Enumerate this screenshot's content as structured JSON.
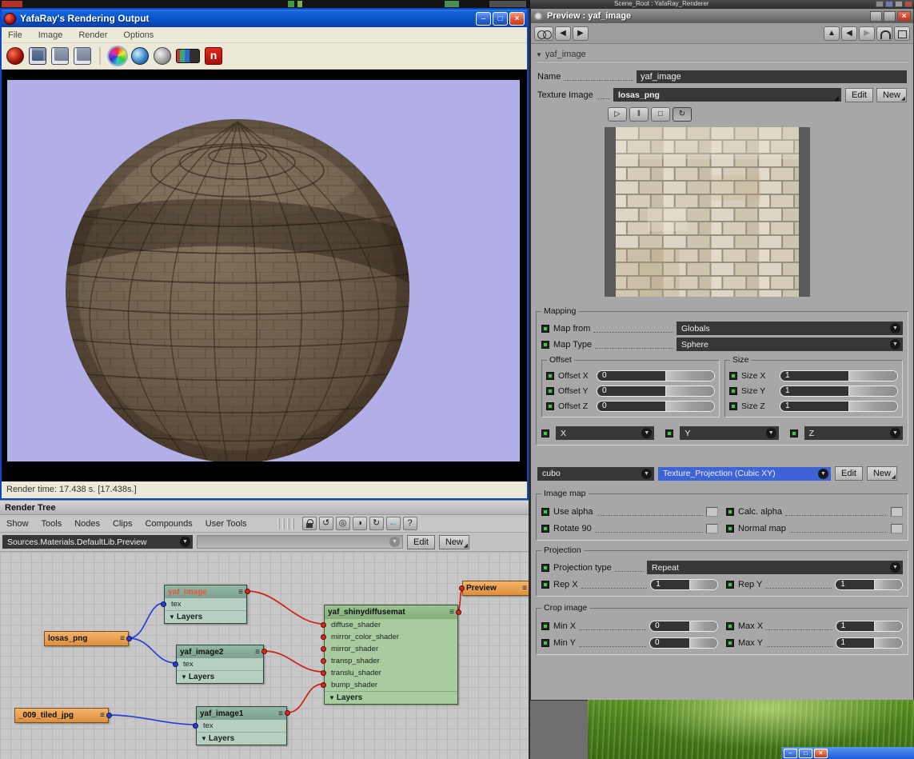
{
  "colors": {
    "xp_titlebar": "#0b51c8",
    "render_background": "#b2afe8",
    "sphere_brown": "#6b5b49",
    "node_image_header": "#86ab99",
    "node_image_body": "#b7cfc0",
    "node_material_header": "#8fbc86",
    "node_material_body": "#a9cba0",
    "node_texture_orange": "#e89a4e",
    "wire_red": "#cc2a1e",
    "wire_blue": "#2a52c8",
    "selected_dropdown_blue": "#3d63d6",
    "dark_field": "#373737"
  },
  "icons": {
    "minimize": "–",
    "maximize": "□",
    "close": "×",
    "play": "▷",
    "pause": "‖",
    "stop": "□",
    "loop": "↻",
    "menu": "≡",
    "collapse": "▼",
    "dropdown": "▼",
    "corner": "◢",
    "back": "←",
    "help": "?",
    "refresh_ccw": "↺",
    "refresh_cw": "↻",
    "circle_half": "◑",
    "target": "◎",
    "prev": "◀",
    "next": "▶",
    "up": "▲"
  },
  "top_strip": {
    "window_title": "Scene_Root : YafaRay_Renderer"
  },
  "yafaray": {
    "title": "YafaRay's Rendering Output",
    "menu": [
      "File",
      "Image",
      "Render",
      "Options"
    ],
    "status": "Render time: 17.438 s. [17.438s.]"
  },
  "render_tree": {
    "title": "Render Tree",
    "menu": [
      "Show",
      "Tools",
      "Nodes",
      "Clips",
      "Compounds",
      "User Tools"
    ],
    "path_value": "Sources.Materials.DefaultLib.Preview",
    "edit_button": "Edit",
    "new_button": "New",
    "nodes": {
      "yaf_image": {
        "title": "yaf_image",
        "port": "tex",
        "footer": "Layers"
      },
      "yaf_image2": {
        "title": "yaf_image2",
        "port": "tex",
        "footer": "Layers"
      },
      "yaf_image1": {
        "title": "yaf_image1",
        "port": "tex",
        "footer": "Layers"
      },
      "losas_png": {
        "title": "losas_png"
      },
      "tiled_jpg": {
        "title": "_009_tiled_jpg"
      },
      "material": {
        "title": "yaf_shinydiffusemat",
        "ports": [
          "diffuse_shader",
          "mirror_color_shader",
          "mirror_shader",
          "transp_shader",
          "translu_shader",
          "bump_shader"
        ],
        "footer": "Layers"
      },
      "preview": {
        "title": "Preview"
      }
    }
  },
  "preview_panel": {
    "title": "Preview : yaf_image",
    "section_header": "yaf_image",
    "name": {
      "label": "Name",
      "value": "yaf_image"
    },
    "texture_image": {
      "label": "Texture Image",
      "value": "losas_png",
      "edit": "Edit",
      "new": "New"
    },
    "mapping": {
      "legend": "Mapping",
      "map_from": {
        "label": "Map from",
        "value": "Globals"
      },
      "map_type": {
        "label": "Map Type",
        "value": "Sphere"
      },
      "offset": {
        "legend": "Offset",
        "rows": [
          {
            "label": "Offset X",
            "value": "0"
          },
          {
            "label": "Offset Y",
            "value": "0"
          },
          {
            "label": "Offset Z",
            "value": "0"
          }
        ]
      },
      "size": {
        "legend": "Size",
        "rows": [
          {
            "label": "Size X",
            "value": "1"
          },
          {
            "label": "Size Y",
            "value": "1"
          },
          {
            "label": "Size Z",
            "value": "1"
          }
        ]
      },
      "axes": [
        {
          "value": "X"
        },
        {
          "value": "Y"
        },
        {
          "value": "Z"
        }
      ]
    },
    "projection_selector": {
      "left_value": "cubo",
      "right_value": "Texture_Projection (Cubic XY)",
      "edit": "Edit",
      "new": "New"
    },
    "image_map": {
      "legend": "Image map",
      "checks": [
        {
          "label": "Use alpha"
        },
        {
          "label": "Calc. alpha"
        },
        {
          "label": "Rotate 90"
        },
        {
          "label": "Normal map"
        }
      ]
    },
    "projection": {
      "legend": "Projection",
      "type": {
        "label": "Projection type",
        "value": "Repeat"
      },
      "rows": [
        {
          "label": "Rep X",
          "value": "1"
        },
        {
          "label": "Rep Y",
          "value": "1"
        }
      ]
    },
    "crop": {
      "legend": "Crop image",
      "rows": [
        {
          "label": "Min X",
          "value": "0"
        },
        {
          "label": "Max X",
          "value": "1"
        },
        {
          "label": "Min Y",
          "value": "0"
        },
        {
          "label": "Max Y",
          "value": "1"
        }
      ]
    }
  }
}
